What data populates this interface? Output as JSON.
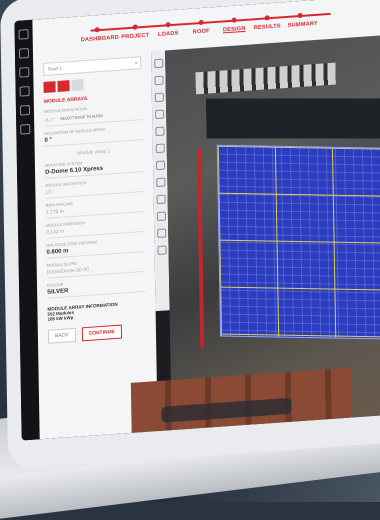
{
  "nav": {
    "steps": [
      {
        "label": "DASHBOARD"
      },
      {
        "label": "PROJECT"
      },
      {
        "label": "LOADS"
      },
      {
        "label": "ROOF"
      },
      {
        "label": "DESIGN"
      },
      {
        "label": "RESULTS"
      },
      {
        "label": "SUMMARY"
      }
    ],
    "active": "DESIGN"
  },
  "panel": {
    "roof_select": "Roof 1",
    "section_title": "MODULE ARRAYS",
    "orientation_label": "MODULE ORIENTATION",
    "orientation_value": "-6.2 °",
    "orientation_action": "SELECT EDGE TO ALIGN",
    "inclination_label": "INCLINATION OF MODULE ARRAY",
    "inclination_value": "0 °",
    "array_select": "Module array 1",
    "mounting_label": "MOUNTING SYSTEM",
    "mounting_value": "D-Dome 6.10 Xpress",
    "tilt_label": "MODULE INCLINATION",
    "tilt_value": "10 °",
    "row_spacing_label": "ROW SPACING",
    "row_spacing_value": "2.276 m",
    "module_dimension_label": "MODULE DIMENSION",
    "module_dimension_value": "0.142 m",
    "min_edge_label": "MIN. EDGE ZONE DISTANCE",
    "min_edge_value": "0.800 m",
    "module_slope_label": "MODULE SLOPE",
    "module_slope_value": "Dome/Dome 90-90",
    "colour_label": "COLOUR",
    "colour_value": "SILVER",
    "info_title": "MODULE ARRAY INFORMATION",
    "info_modules": "552 Modules",
    "info_kwp": "185 kW kWp",
    "back_label": "BACK",
    "continue_label": "CONTINUE"
  }
}
